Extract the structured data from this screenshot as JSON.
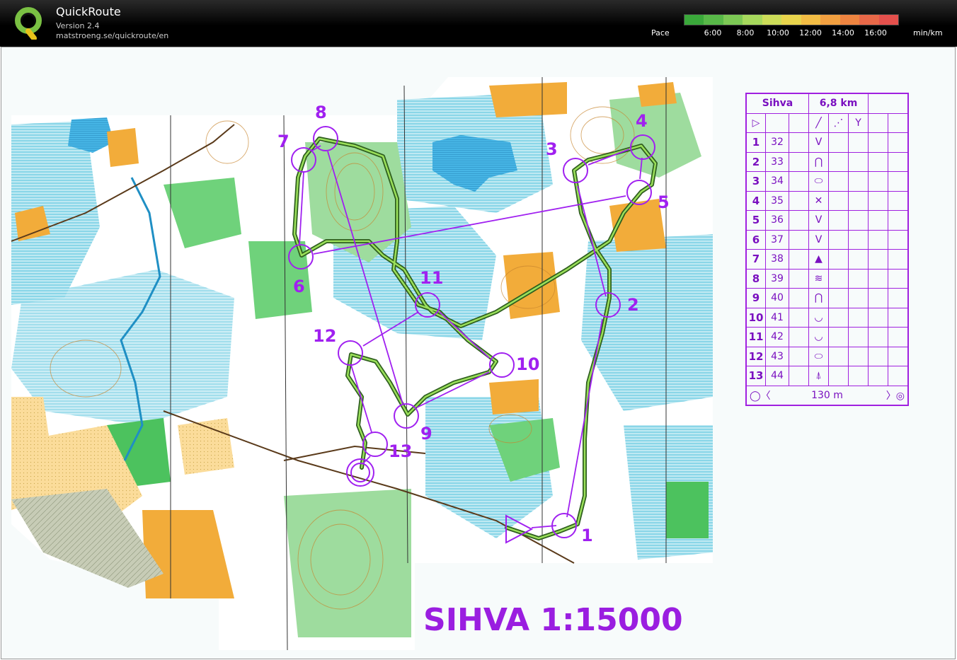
{
  "app": {
    "title": "QuickRoute",
    "version": "Version 2.4",
    "url": "matstroeng.se/quickroute/en"
  },
  "pace": {
    "label": "Pace",
    "ticks": [
      "6:00",
      "8:00",
      "10:00",
      "12:00",
      "14:00",
      "16:00"
    ],
    "unit": "min/km",
    "gradient_colors": [
      "#3aa83a",
      "#58b848",
      "#7cc854",
      "#a6d85c",
      "#ccdc58",
      "#e8d44c",
      "#f2bc44",
      "#f2a040",
      "#ee8440",
      "#e86848",
      "#e4504c"
    ]
  },
  "colors": {
    "course": "#a020f0",
    "route_dark": "#2f5f1f",
    "route_light": "#9be05a"
  },
  "course": {
    "name": "Sihva",
    "length": "6,8 km",
    "map_title": "SIHVA 1:15000",
    "finish_distance": "130 m",
    "controls": [
      {
        "num": "1",
        "code": "32",
        "symbol": "V"
      },
      {
        "num": "2",
        "code": "33",
        "symbol": "⋂"
      },
      {
        "num": "3",
        "code": "34",
        "symbol": "⬭"
      },
      {
        "num": "4",
        "code": "35",
        "symbol": "✕"
      },
      {
        "num": "5",
        "code": "36",
        "symbol": "V"
      },
      {
        "num": "6",
        "code": "37",
        "symbol": "V"
      },
      {
        "num": "7",
        "code": "38",
        "symbol": "▲"
      },
      {
        "num": "8",
        "code": "39",
        "symbol": "≋"
      },
      {
        "num": "9",
        "code": "40",
        "symbol": "⋂"
      },
      {
        "num": "10",
        "code": "41",
        "symbol": "◡"
      },
      {
        "num": "11",
        "code": "42",
        "symbol": "◡"
      },
      {
        "num": "12",
        "code": "43",
        "symbol": "⬭"
      },
      {
        "num": "13",
        "code": "44",
        "symbol": "⍋"
      }
    ]
  }
}
